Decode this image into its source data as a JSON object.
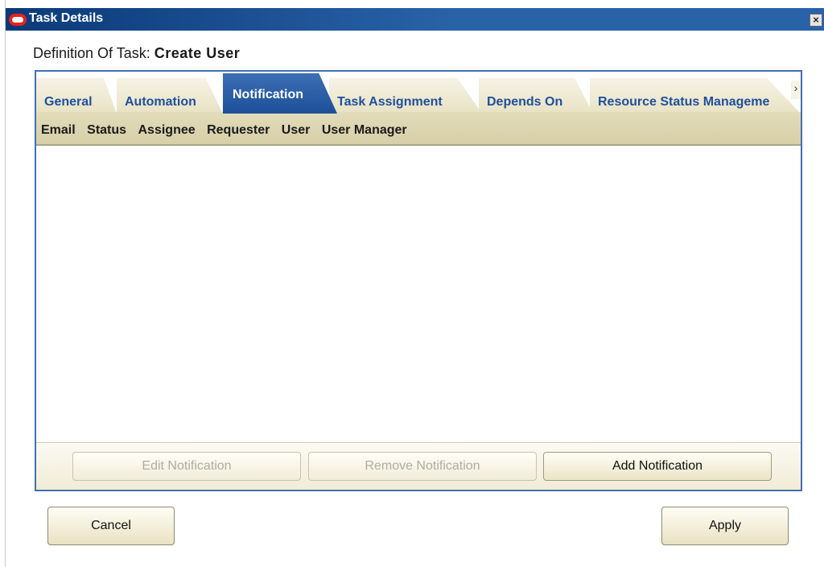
{
  "window": {
    "title": "Task Details"
  },
  "definition": {
    "label": "Definition Of Task:",
    "task_name": "Create User"
  },
  "tabs": [
    {
      "label": "General"
    },
    {
      "label": "Automation"
    },
    {
      "label": "Notification",
      "active": true
    },
    {
      "label": "Task Assignment"
    },
    {
      "label": "Depends On"
    },
    {
      "label": "Resource Status Manageme"
    }
  ],
  "columns": [
    "Email",
    "Status",
    "Assignee",
    "Requester",
    "User",
    "User Manager"
  ],
  "actions": {
    "edit_label": "Edit Notification",
    "remove_label": "Remove Notification",
    "add_label": "Add Notification"
  },
  "footer": {
    "cancel_label": "Cancel",
    "apply_label": "Apply"
  },
  "colors": {
    "title_bar": "#2a62a8",
    "active_tab": "#1c4f98",
    "tab_bg": "#e8e2c4",
    "header_bg": "#d6cfa7"
  }
}
